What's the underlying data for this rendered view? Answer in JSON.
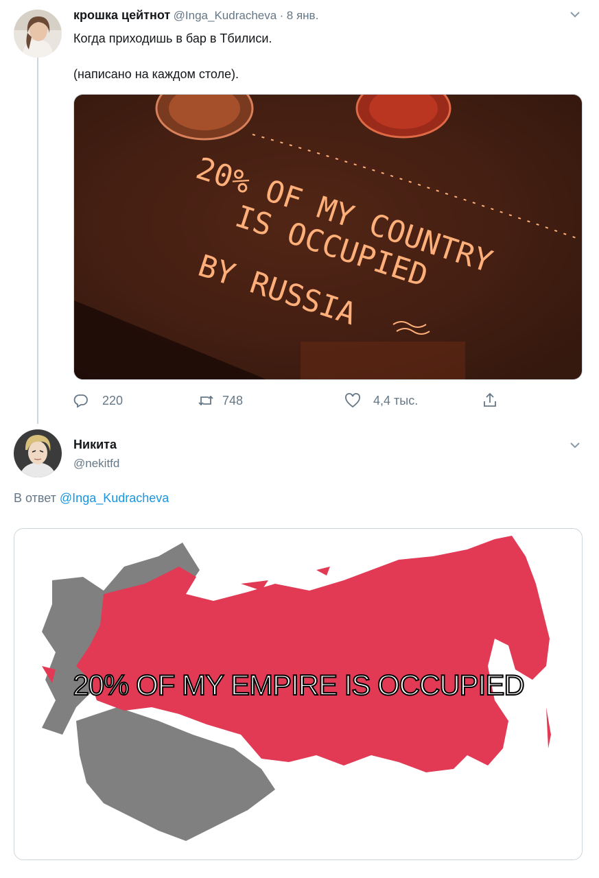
{
  "tweet1": {
    "display_name": "крошка цейтнот",
    "handle": "@Inga_Kudracheva",
    "sep": "·",
    "date": "8 янв.",
    "text_line1": "Когда приходишь в бар в Тбилиси.",
    "text_line2": "(написано на каждом столе).",
    "image_text": [
      "20% OF MY COUNTRY",
      "IS OCCUPIED",
      "BY RUSSIA"
    ],
    "replies": "220",
    "retweets": "748",
    "likes": "4,4 тыс."
  },
  "tweet2": {
    "display_name": "Никита",
    "handle": "@nekitfd",
    "reply_prefix": "В ответ",
    "reply_to": "@Inga_Kudracheva",
    "image_caption": "20% OF MY EMPIRE IS OCCUPIED"
  },
  "colors": {
    "accent": "#1b95e0",
    "map_red": "#e23a55",
    "map_grey": "#808080",
    "chalk": "#ffb07a"
  },
  "icons": [
    "chevron-down-icon",
    "reply-icon",
    "retweet-icon",
    "like-icon",
    "share-icon"
  ]
}
